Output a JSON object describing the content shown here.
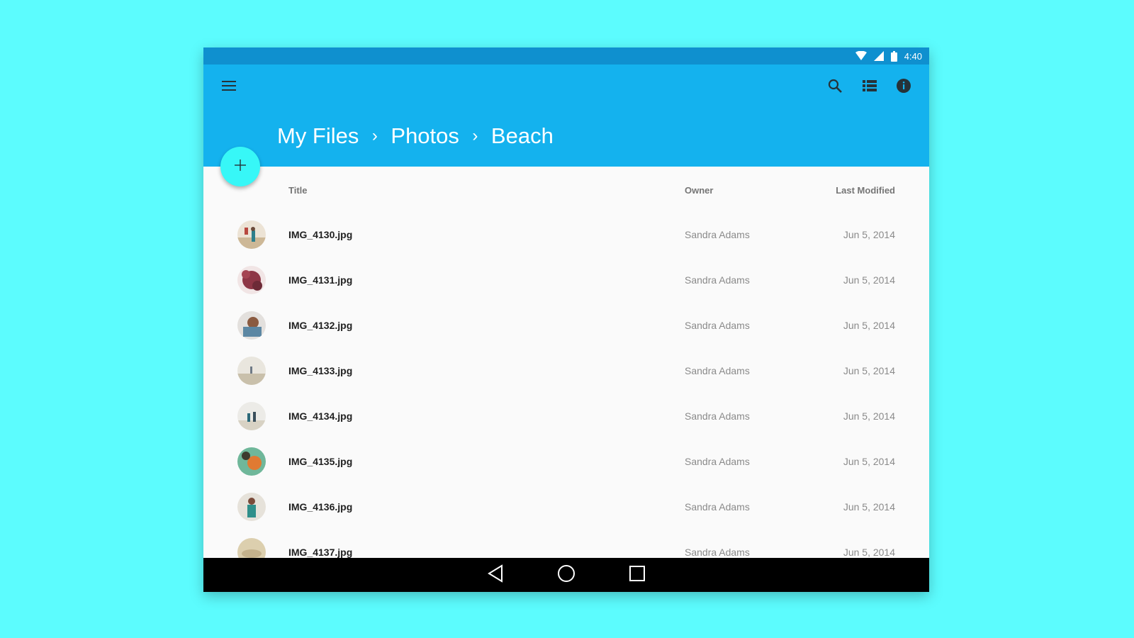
{
  "status_bar": {
    "time": "4:40",
    "icons": [
      "wifi-icon",
      "signal-icon",
      "battery-icon"
    ]
  },
  "app_bar": {
    "menu_icon": "menu-icon",
    "actions": [
      "search-icon",
      "list-view-icon",
      "info-icon"
    ],
    "breadcrumb": [
      "My Files",
      "Photos",
      "Beach"
    ],
    "separator": "›"
  },
  "fab": {
    "icon": "plus-icon",
    "label": "+"
  },
  "table": {
    "columns": {
      "title": "Title",
      "owner": "Owner",
      "modified": "Last Modified"
    },
    "rows": [
      {
        "title": "IMG_4130.jpg",
        "owner": "Sandra Adams",
        "date": "Jun 5, 2014"
      },
      {
        "title": "IMG_4131.jpg",
        "owner": "Sandra Adams",
        "date": "Jun 5, 2014"
      },
      {
        "title": "IMG_4132.jpg",
        "owner": "Sandra Adams",
        "date": "Jun 5, 2014"
      },
      {
        "title": "IMG_4133.jpg",
        "owner": "Sandra Adams",
        "date": "Jun 5, 2014"
      },
      {
        "title": "IMG_4134.jpg",
        "owner": "Sandra Adams",
        "date": "Jun 5, 2014"
      },
      {
        "title": "IMG_4135.jpg",
        "owner": "Sandra Adams",
        "date": "Jun 5, 2014"
      },
      {
        "title": "IMG_4136.jpg",
        "owner": "Sandra Adams",
        "date": "Jun 5, 2014"
      },
      {
        "title": "IMG_4137.jpg",
        "owner": "Sandra Adams",
        "date": "Jun 5, 2014"
      }
    ]
  },
  "nav_bar": {
    "buttons": [
      "back-icon",
      "home-icon",
      "recents-icon"
    ]
  },
  "colors": {
    "background": "#5cfcfe",
    "status_bar": "#0f90cf",
    "app_bar": "#14b2ee",
    "fab": "#37f7f7",
    "nav_bar": "#000000"
  }
}
